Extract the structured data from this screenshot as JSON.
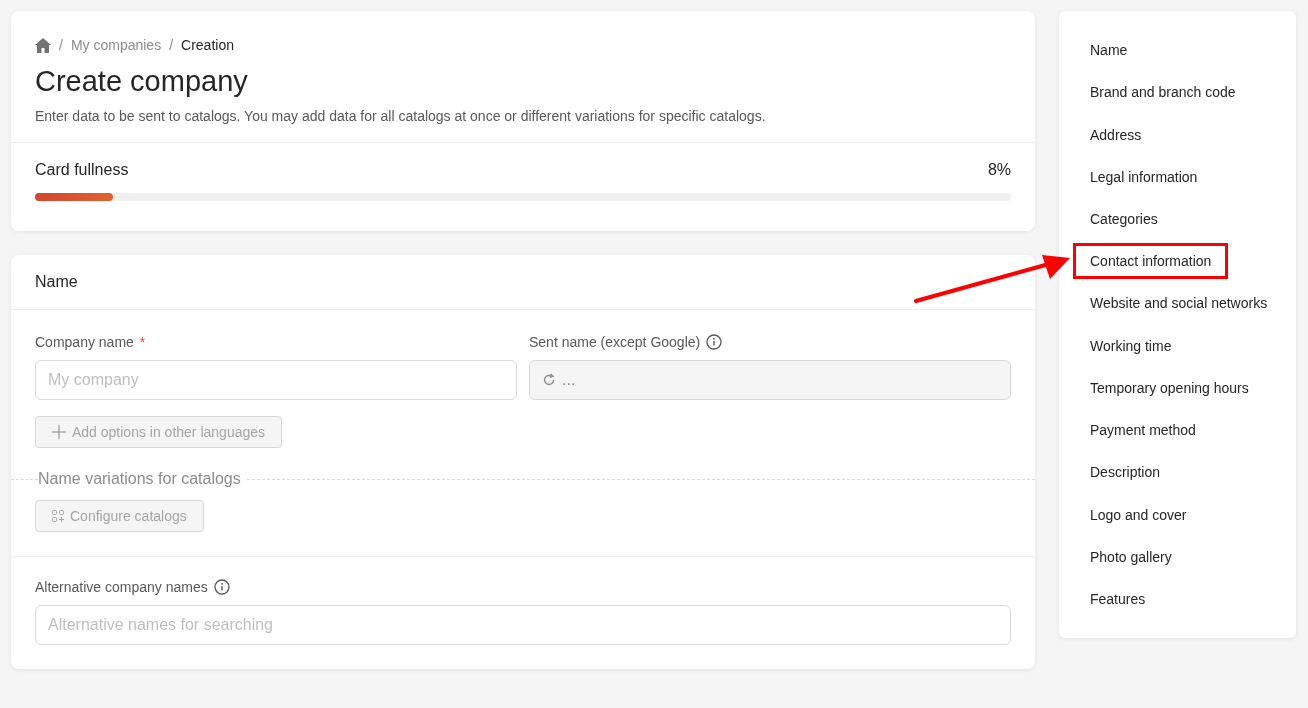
{
  "breadcrumbs": [
    {
      "separator": "/",
      "label": "My companies"
    },
    {
      "separator": "/",
      "label": "Creation"
    }
  ],
  "title": "Create company",
  "description": "Enter data to be sent to catalogs. You may add data for all catalogs at once or different variations for specific catalogs.",
  "fullness": {
    "label": "Card fullness",
    "reading": "8%",
    "level": 0.08
  },
  "name_section": {
    "title": "Name",
    "company_name": {
      "label": "Company name",
      "required_mark": "*",
      "placeholder": "My company"
    },
    "sent_name": {
      "label": "Sent name (except Google)",
      "value": "...",
      "disabled": true
    },
    "add_languages_button": "Add options in other languages",
    "variations_heading": "Name variations for catalogs",
    "configure_button": "Configure catalogs",
    "alternative_names": {
      "label": "Alternative company names",
      "placeholder": "Alternative names for searching"
    }
  },
  "nav": [
    {
      "label": "Name",
      "highlighted": false
    },
    {
      "label": "Brand and branch code",
      "highlighted": false
    },
    {
      "label": "Address",
      "highlighted": false
    },
    {
      "label": "Legal information",
      "highlighted": false
    },
    {
      "label": "Categories",
      "highlighted": false
    },
    {
      "label": "Contact information",
      "highlighted": true
    },
    {
      "label": "Website and social networks",
      "highlighted": false
    },
    {
      "label": "Working time",
      "highlighted": false
    },
    {
      "label": "Temporary opening hours",
      "highlighted": false
    },
    {
      "label": "Payment method",
      "highlighted": false
    },
    {
      "label": "Description",
      "highlighted": false
    },
    {
      "label": "Logo and cover",
      "highlighted": false
    },
    {
      "label": "Photo gallery",
      "highlighted": false
    },
    {
      "label": "Features",
      "highlighted": false
    }
  ]
}
